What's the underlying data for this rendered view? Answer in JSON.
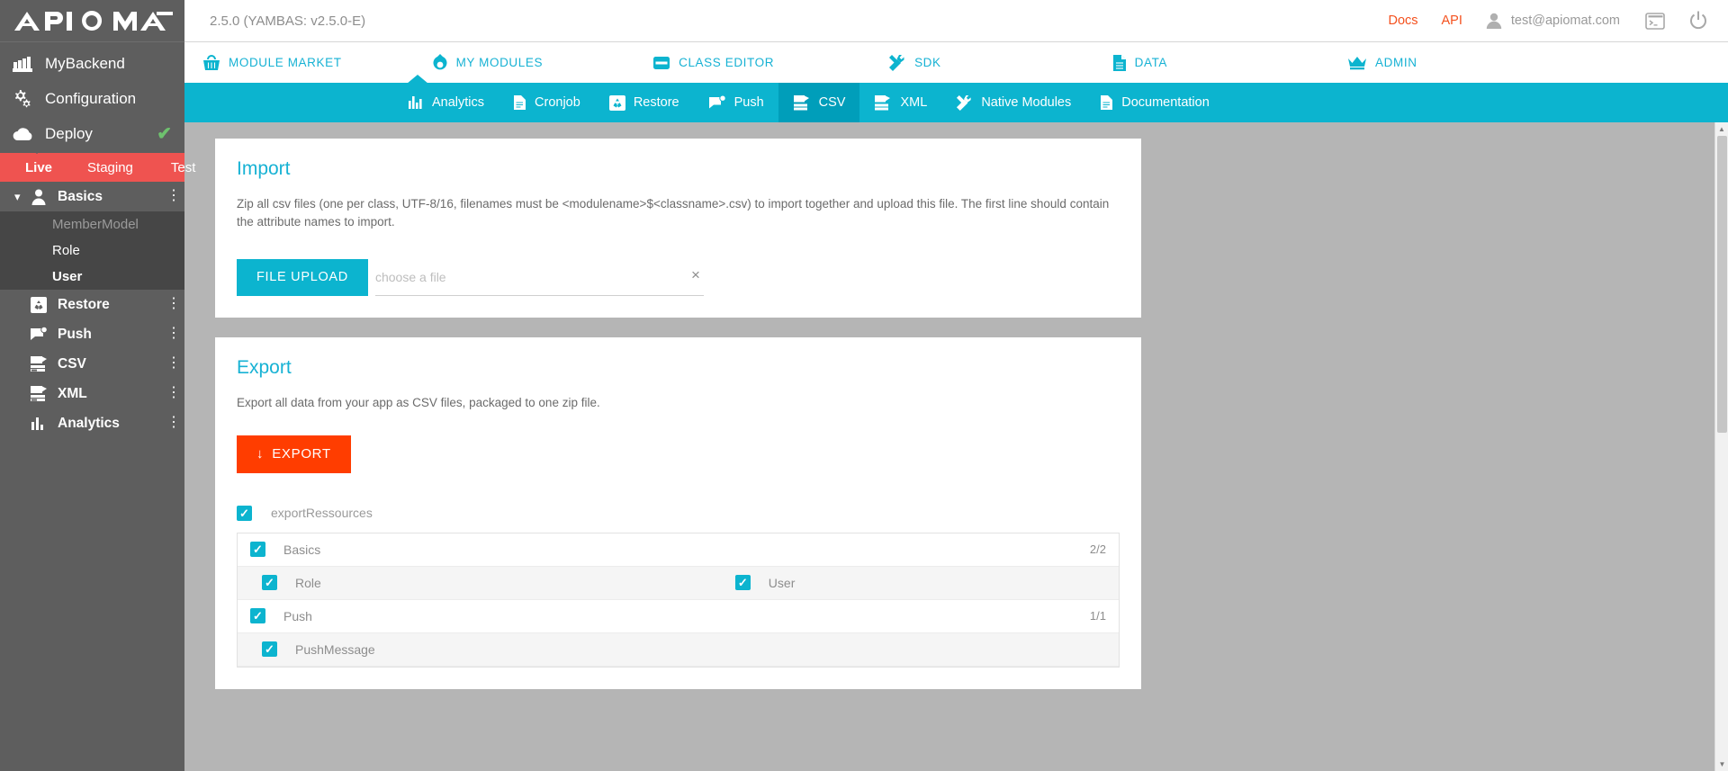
{
  "sidebar": {
    "logo": "APIOMAT",
    "nav": [
      {
        "label": "MyBackend",
        "icon": "factory-icon"
      },
      {
        "label": "Configuration",
        "icon": "gears-icon"
      },
      {
        "label": "Deploy",
        "icon": "cloud-icon",
        "status": "✔"
      }
    ],
    "environments": [
      {
        "label": "Live",
        "active": true
      },
      {
        "label": "Staging",
        "active": false
      },
      {
        "label": "Test",
        "active": false
      }
    ],
    "modules": [
      {
        "label": "Basics",
        "icon": "user-icon",
        "expanded": true,
        "chevron": "down",
        "menu": "⋮"
      },
      {
        "label": "Restore",
        "icon": "restore-icon",
        "expanded": false,
        "chevron": "",
        "menu": "⋮"
      },
      {
        "label": "Push",
        "icon": "push-icon",
        "expanded": false,
        "chevron": "right",
        "menu": "⋮"
      },
      {
        "label": "CSV",
        "icon": "csv-icon",
        "expanded": false,
        "chevron": "",
        "menu": "⋮"
      },
      {
        "label": "XML",
        "icon": "xml-icon",
        "expanded": false,
        "chevron": "",
        "menu": "⋮"
      },
      {
        "label": "Analytics",
        "icon": "analytics-icon",
        "expanded": false,
        "chevron": "",
        "menu": "⋮"
      }
    ],
    "basics_children": [
      {
        "label": "MemberModel",
        "state": "dim"
      },
      {
        "label": "Role",
        "state": "normal"
      },
      {
        "label": "User",
        "state": "bold"
      }
    ]
  },
  "topbar": {
    "version": "2.5.0 (YAMBAS: v2.5.0-E)",
    "docs": "Docs",
    "api": "API",
    "email": "test@apiomat.com",
    "console_icon": "terminal-icon",
    "power_icon": "power-icon",
    "user_icon": "user-avatar-icon",
    "link_color": "#f4511e"
  },
  "main_tabs": [
    {
      "label": "MODULE MARKET",
      "icon": "basket-icon",
      "active": false
    },
    {
      "label": "MY MODULES",
      "icon": "module-icon",
      "active": true
    },
    {
      "label": "CLASS EDITOR",
      "icon": "class-icon",
      "active": false
    },
    {
      "label": "SDK",
      "icon": "tools-icon",
      "active": false
    },
    {
      "label": "DATA",
      "icon": "document-icon",
      "active": false
    },
    {
      "label": "ADMIN",
      "icon": "crown-icon",
      "active": false
    }
  ],
  "sub_tabs": [
    {
      "label": "Analytics",
      "icon": "analytics-icon",
      "active": false
    },
    {
      "label": "Cronjob",
      "icon": "cronjob-icon",
      "active": false
    },
    {
      "label": "Restore",
      "icon": "restore-icon",
      "active": false
    },
    {
      "label": "Push",
      "icon": "push-icon",
      "active": false
    },
    {
      "label": "CSV",
      "icon": "csv-icon",
      "active": true
    },
    {
      "label": "XML",
      "icon": "xml-icon",
      "active": false
    },
    {
      "label": "Native Modules",
      "icon": "native-modules-icon",
      "active": false
    },
    {
      "label": "Documentation",
      "icon": "documentation-icon",
      "active": false
    }
  ],
  "import": {
    "title": "Import",
    "description": "Zip all csv files (one per class, UTF-8/16, filenames must be <modulename>$<classname>.csv) to import together and upload this file. The first line should contain the attribute names to import.",
    "upload_button": "FILE UPLOAD",
    "file_placeholder": "choose a file",
    "file_value": "",
    "clear_icon": "×"
  },
  "export": {
    "title": "Export",
    "description": "Export all data from your app as CSV files, packaged to one zip file.",
    "button_label": "EXPORT",
    "button_icon": "↓",
    "button_color": "#ff3d00",
    "resources_label": "exportRessources",
    "resources_checked": true,
    "groups": [
      {
        "label": "Basics",
        "checked": true,
        "count": "2/2",
        "children": [
          {
            "label": "Role",
            "checked": true
          },
          {
            "label": "User",
            "checked": true
          }
        ]
      },
      {
        "label": "Push",
        "checked": true,
        "count": "1/1",
        "children": [
          {
            "label": "PushMessage",
            "checked": true
          }
        ]
      }
    ]
  },
  "scrollbar": {
    "up": "▲",
    "down": "▼"
  }
}
